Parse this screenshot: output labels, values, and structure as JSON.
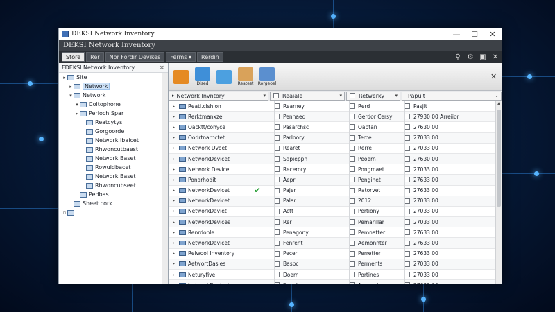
{
  "window": {
    "title": "DEKSI Network Inventory",
    "heading": "DEKSI Network Inventory",
    "controls": {
      "minimize": "—",
      "maximize": "☐",
      "close": "✕"
    }
  },
  "tabs": [
    "Store",
    "Rer",
    "Nor  Fordir Devikes",
    "Ferms ▾",
    "Rerdin"
  ],
  "tree": {
    "header": "FDEKSI Network Inventory",
    "close": "✕",
    "nodes": [
      {
        "toggle": "▸",
        "label": "Site",
        "indent": 0
      },
      {
        "toggle": "▸",
        "label": "Network",
        "indent": 1,
        "selected": true
      },
      {
        "toggle": "▾",
        "label": "Network",
        "indent": 1
      },
      {
        "toggle": "▾",
        "label": "Coltophone",
        "indent": 2
      },
      {
        "toggle": "▸",
        "label": "Perloch Spar",
        "indent": 2
      },
      {
        "toggle": "",
        "label": "Reatcytys",
        "indent": 3
      },
      {
        "toggle": "",
        "label": "Gorgoorde",
        "indent": 3
      },
      {
        "toggle": "",
        "label": "Network Ibaicet",
        "indent": 3
      },
      {
        "toggle": "",
        "label": "Rhwoncutbaest",
        "indent": 3
      },
      {
        "toggle": "",
        "label": "Network Baset",
        "indent": 3
      },
      {
        "toggle": "",
        "label": "Rowuidbacet",
        "indent": 3
      },
      {
        "toggle": "",
        "label": "Network Baset",
        "indent": 3
      },
      {
        "toggle": "",
        "label": "Rhwoncubseet",
        "indent": 3
      },
      {
        "toggle": "",
        "label": "Pedbas",
        "indent": 2
      },
      {
        "toggle": "",
        "label": "Sheet cork",
        "indent": 1
      },
      {
        "toggle": "▫",
        "label": "",
        "indent": 0
      }
    ]
  },
  "toolbar": {
    "buttons": [
      {
        "label": "",
        "color": "#e58a23"
      },
      {
        "label": "Dised",
        "color": "#3f8fd8"
      },
      {
        "label": "",
        "color": "#4ca0e0"
      },
      {
        "label": "Reatest",
        "color": "#d9a25a"
      },
      {
        "label": "Rorgeoel",
        "color": "#5b8fcf"
      }
    ],
    "close": "✕"
  },
  "columns": [
    "Network Invntory",
    "Reaiale",
    "Retwerky",
    "Papult"
  ],
  "rows": [
    {
      "name": "Reati.clshion",
      "check": false,
      "c3": "Rearney",
      "c4": "Rerd",
      "c5": "Pasjlt"
    },
    {
      "name": "Rerktmanxze",
      "check": false,
      "c3": "Pennaed",
      "c4": "Gerdor Cersy",
      "c5": "27930 00 Arreiior"
    },
    {
      "name": "Oacktt/cohyce",
      "check": false,
      "c3": "Pasarchsc",
      "c4": "Oaptan",
      "c5": "27630 00"
    },
    {
      "name": "Oodrtnarhctet",
      "check": false,
      "c3": "Parloory",
      "c4": "Terce",
      "c5": "27033 00"
    },
    {
      "name": "Network Dvoet",
      "check": false,
      "c3": "Rearet",
      "c4": "Rerre",
      "c5": "27033 00"
    },
    {
      "name": "NetworkDevicet",
      "check": false,
      "c3": "Sapieppn",
      "c4": "Peoern",
      "c5": "27630 00"
    },
    {
      "name": "Network Device",
      "check": false,
      "c3": "Recerory",
      "c4": "Pongmaet",
      "c5": "27033 00"
    },
    {
      "name": "Ponarhodit",
      "check": false,
      "c3": "Aepr",
      "c4": "Penginet",
      "c5": "27633 00"
    },
    {
      "name": "NetworkDevicet",
      "check": true,
      "c3": "Pajer",
      "c4": "Ratorvet",
      "c5": "27633 00"
    },
    {
      "name": "NetworkDevicet",
      "check": false,
      "c3": "Palar",
      "c4": "2012",
      "c5": "27033 00"
    },
    {
      "name": "NetworkDaviet",
      "check": false,
      "c3": "Actt",
      "c4": "Pertiony",
      "c5": "27033 00"
    },
    {
      "name": "NetworkDevices",
      "check": false,
      "c3": "Rer",
      "c4": "Pemarillar",
      "c5": "27033 00"
    },
    {
      "name": "Renrdonle",
      "check": false,
      "c3": "Penagony",
      "c4": "Pemnatter",
      "c5": "27633 00"
    },
    {
      "name": "NetworkDavicet",
      "check": false,
      "c3": "Fenrent",
      "c4": "Aemonnter",
      "c5": "27633 00"
    },
    {
      "name": "Relwool Inventory",
      "check": false,
      "c3": "Pecer",
      "c4": "Perretter",
      "c5": "27633 00"
    },
    {
      "name": "AetwortDasies",
      "check": false,
      "c3": "Baspc",
      "c4": "Perments",
      "c5": "27033 00"
    },
    {
      "name": "Neturyfive",
      "check": false,
      "c3": "Doerr",
      "c4": "Portines",
      "c5": "27033 00"
    },
    {
      "name": "NetworkDevicet",
      "check": false,
      "c3": "Feerd",
      "c4": "Aremmier",
      "c5": "27633 00"
    },
    {
      "name": "NetworkDebices",
      "check": false,
      "c3": "Pesner",
      "c4": "Pecarrler",
      "c5": "27633 00"
    }
  ]
}
